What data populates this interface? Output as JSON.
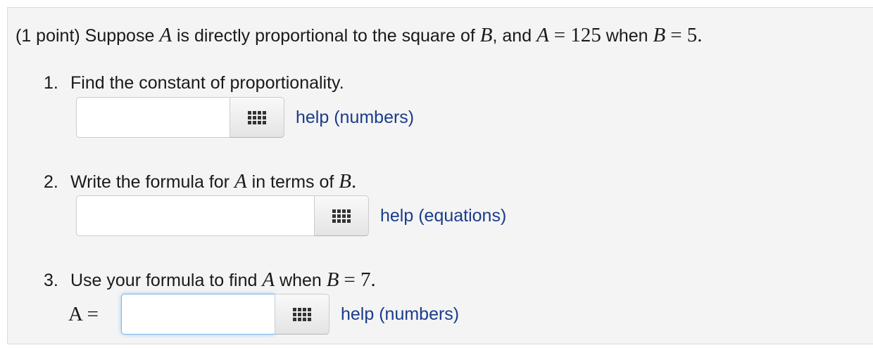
{
  "problem": {
    "intro_prefix": "(1 point) Suppose",
    "var_a": "A",
    "intro_mid1": "is directly proportional to the square of",
    "var_b": "B",
    "intro_mid2": ", and",
    "eq1": "= 125",
    "intro_when": "when",
    "eq2": "= 5."
  },
  "questions": [
    {
      "number": "1.",
      "text": "Find the constant of proportionality.",
      "input_value": "",
      "help_label": "help (numbers)"
    },
    {
      "number": "2.",
      "text_prefix": "Write the formula for",
      "text_mid": "in terms of",
      "text_end": ".",
      "input_value": "",
      "help_label": "help (equations)"
    },
    {
      "number": "3.",
      "text_prefix": "Use your formula to find",
      "text_mid": "when",
      "eq": "= 7.",
      "answer_label": "A =",
      "input_value": "",
      "help_label": "help (numbers)"
    }
  ],
  "icons": {
    "palette": "grid-icon"
  },
  "colors": {
    "link": "#1a3c8c",
    "focus": "#7fb5e8",
    "panel": "#f4f4f4"
  }
}
